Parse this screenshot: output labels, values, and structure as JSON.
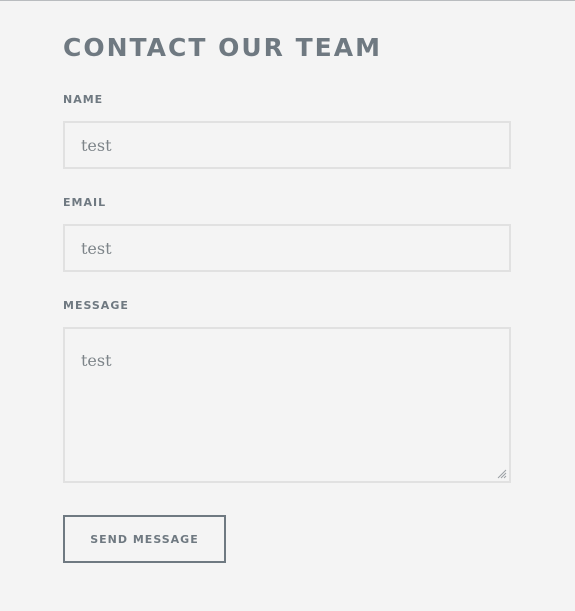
{
  "form": {
    "title": "CONTACT OUR TEAM",
    "fields": {
      "name": {
        "label": "NAME",
        "value": "test"
      },
      "email": {
        "label": "EMAIL",
        "value": "test"
      },
      "message": {
        "label": "MESSAGE",
        "value": "test"
      }
    },
    "submit_label": "SEND MESSAGE"
  },
  "icons": {
    "resize": "resize-grip-icon"
  },
  "colors": {
    "background": "#f4f4f4",
    "text": "#6f7981",
    "field_border": "#e1e1e1",
    "field_text": "#7d8489"
  }
}
